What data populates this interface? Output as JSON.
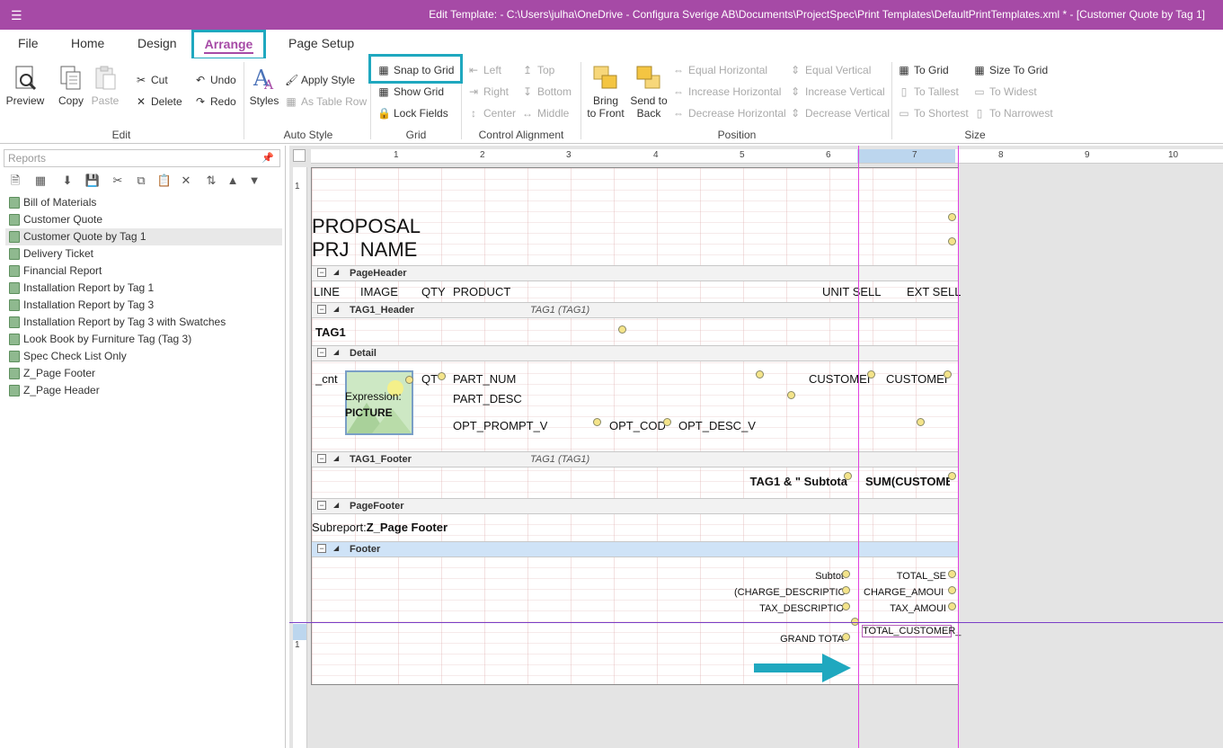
{
  "titlebar": {
    "title": "Edit Template:  - C:\\Users\\julha\\OneDrive - Configura Sverige AB\\Documents\\ProjectSpec\\Print Templates\\DefaultPrintTemplates.xml * - [Customer Quote by Tag 1]"
  },
  "tabs": {
    "file": "File",
    "home": "Home",
    "design": "Design",
    "arrange": "Arrange",
    "page_setup": "Page Setup"
  },
  "ribbon": {
    "preview": "Preview",
    "copy": "Copy",
    "paste": "Paste",
    "cut": "Cut",
    "delete": "Delete",
    "undo": "Undo",
    "redo": "Redo",
    "edit_group": "Edit",
    "styles": "Styles",
    "apply_style": "Apply Style",
    "as_table_row": "As Table Row",
    "auto_style_group": "Auto Style",
    "snap_to_grid": "Snap to Grid",
    "show_grid": "Show Grid",
    "lock_fields": "Lock Fields",
    "grid_group": "Grid",
    "left": "Left",
    "right": "Right",
    "center": "Center",
    "top": "Top",
    "bottom": "Bottom",
    "middle": "Middle",
    "control_alignment_group": "Control Alignment",
    "bring_to_front_1": "Bring",
    "bring_to_front_2": "to Front",
    "send_to_back_1": "Send to",
    "send_to_back_2": "Back",
    "equal_horizontal": "Equal Horizontal",
    "increase_horizontal": "Increase Horizontal",
    "decrease_horizontal": "Decrease Horizontal",
    "equal_vertical": "Equal Vertical",
    "increase_vertical": "Increase Vertical",
    "decrease_vertical": "Decrease Vertical",
    "position_group": "Position",
    "to_grid": "To Grid",
    "to_tallest": "To Tallest",
    "to_shortest": "To Shortest",
    "size_to_grid": "Size To Grid",
    "to_widest": "To Widest",
    "to_narrowest": "To Narrowest",
    "size_group": "Size"
  },
  "left_panel": {
    "search_placeholder": "Reports",
    "reports": [
      "Bill of Materials",
      "Customer Quote",
      "Customer Quote by Tag 1",
      "Delivery Ticket",
      "Financial Report",
      "Installation Report by Tag 1",
      "Installation Report by Tag 3",
      "Installation Report by Tag 3 with Swatches",
      "Look Book by Furniture Tag (Tag 3)",
      "Spec Check List Only",
      "Z_Page Footer",
      "Z_Page Header"
    ],
    "selected_report": "Customer Quote by Tag 1"
  },
  "ruler": {
    "top_numbers": [
      "1",
      "2",
      "3",
      "4",
      "5",
      "6",
      "7",
      "8",
      "9",
      "10"
    ],
    "left_numbers": [
      "1",
      "1"
    ]
  },
  "designer": {
    "report_header": {
      "title1": "PROPOSAL",
      "title2": "PRJ_NAME"
    },
    "bands": {
      "page_header": "PageHeader",
      "tag1_header": "TAG1_Header",
      "tag1_header_sub": "TAG1 (TAG1)",
      "detail": "Detail",
      "tag1_footer": "TAG1_Footer",
      "tag1_footer_sub": "TAG1 (TAG1)",
      "page_footer": "PageFooter",
      "footer": "Footer"
    },
    "page_header_fields": {
      "line": "LINE",
      "image": "IMAGE",
      "qty": "QTY",
      "product": "PRODUCT",
      "unit_sell": "UNIT SELL",
      "ext_sell": "EXT SELL"
    },
    "tag1_header_field": "TAG1",
    "detail_fields": {
      "cnt": "_cnt",
      "expression": "Expression:",
      "picture": "PICTURE",
      "qty": "QT",
      "part_num": "PART_NUM",
      "part_desc": "PART_DESC",
      "opt_prompt": "OPT_PROMPT_V",
      "opt_code": "OPT_COD",
      "opt_desc": "OPT_DESC_V",
      "customer1": "CUSTOMEI",
      "customer2": "CUSTOMEI"
    },
    "tag1_footer_fields": {
      "subtotal": "TAG1 & \"  Subtota",
      "sum": "SUM(CUSTOME"
    },
    "page_footer_fields": {
      "label": "Subreport:",
      "value": "Z_Page Footer"
    },
    "footer_fields": {
      "subtotal": "Subtot",
      "charge_desc": "(CHARGE_DESCRIPTIO",
      "tax_desc": "TAX_DESCRIPTIO",
      "grand_total": "GRAND TOTA",
      "total_se": "TOTAL_SE",
      "charge_amount": "CHARGE_AMOUI",
      "tax_amount": "TAX_AMOUI",
      "total_customer": "TOTAL_CUSTOMER_"
    }
  },
  "colors": {
    "accent": "#a64aa6",
    "highlight": "#1fa8bf",
    "guide": "#e040e0"
  }
}
